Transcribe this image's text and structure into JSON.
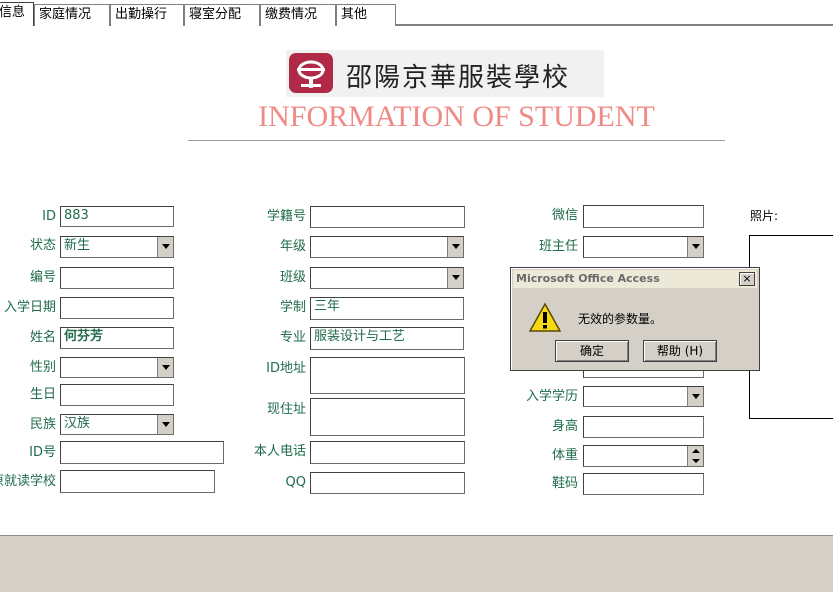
{
  "tabs": [
    {
      "label": "信息",
      "active": true
    },
    {
      "label": "家庭情况"
    },
    {
      "label": "出勤操行"
    },
    {
      "label": "寝室分配"
    },
    {
      "label": "缴费情况"
    },
    {
      "label": "其他"
    }
  ],
  "header": {
    "school_name": "邵陽京華服裝學校",
    "headline": "INFORMATION OF STUDENT"
  },
  "labels": {
    "id": "ID",
    "status": "状态",
    "code": "编号",
    "enroll_date": "入学日期",
    "name": "姓名",
    "gender": "性别",
    "birthday": "生日",
    "ethnicity": "民族",
    "id_number": "ID号",
    "former_school": "原就读学校",
    "student_no": "学籍号",
    "grade": "年级",
    "class": "班级",
    "schooling": "学制",
    "major": "专业",
    "id_address": "ID地址",
    "current_address": "现住址",
    "phone": "本人电话",
    "qq": "QQ",
    "wechat": "微信",
    "head_teacher": "班主任",
    "education": "入学学历",
    "height": "身高",
    "weight": "体重",
    "shoe_size": "鞋码",
    "photo": "照片:"
  },
  "values": {
    "id": "883",
    "status": "新生",
    "code": "",
    "enroll_date": "",
    "name": "何芬芳",
    "gender": "",
    "birthday": "",
    "ethnicity": "汉族",
    "id_number": "",
    "former_school": "",
    "student_no": "",
    "grade": "",
    "class": "",
    "schooling": "三年",
    "major": "服装设计与工艺",
    "id_address": "",
    "current_address": "",
    "phone": "",
    "qq": "",
    "wechat": "",
    "head_teacher": "",
    "education": "",
    "height": "",
    "weight": "",
    "shoe_size": ""
  },
  "dialog": {
    "title": "Microsoft Office Access",
    "close": "×",
    "message": "无效的参数量。",
    "ok_label": "确定",
    "help_label": "帮助 (H)",
    "icon": "warning-icon"
  },
  "colors": {
    "label": "#1f6b4b",
    "headline": "#f08a86",
    "logo_mark": "#b02a47"
  }
}
